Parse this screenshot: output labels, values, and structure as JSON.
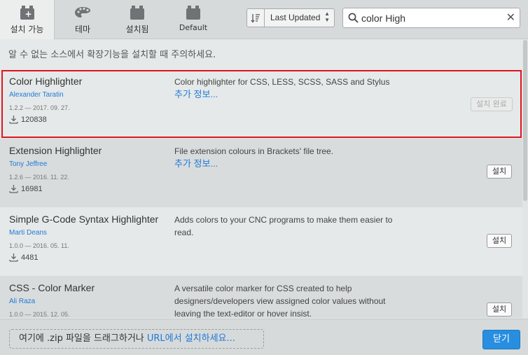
{
  "tabs": [
    {
      "label": "설치 가능",
      "icon": "box-plus-icon",
      "active": true
    },
    {
      "label": "테마",
      "icon": "palette-icon",
      "active": false
    },
    {
      "label": "설치됨",
      "icon": "box-icon",
      "active": false
    },
    {
      "label": "Default",
      "icon": "box-icon",
      "active": false
    }
  ],
  "sort": {
    "label": "Last Updated"
  },
  "search": {
    "value": "color High",
    "placeholder": ""
  },
  "warning": "알 수 없는 소스에서 확장기능을 설치할 때 주의하세요.",
  "extensions": [
    {
      "name": "Color Highlighter",
      "author": "Alexander Taratin",
      "version_date": "1.2.2 — 2017. 09. 27.",
      "downloads": "120838",
      "description": "Color highlighter for CSS, LESS, SCSS, SASS and Stylus",
      "more_info": "추가 정보...",
      "action": "설치 완료"
    },
    {
      "name": "Extension Highlighter",
      "author": "Tony Jeffree",
      "version_date": "1.2.6 — 2016. 11. 22.",
      "downloads": "16981",
      "description": "File extension colours in Brackets' file tree.",
      "more_info": "추가 정보...",
      "action": "설치"
    },
    {
      "name": "Simple G-Code Syntax Highlighter",
      "author": "Marti Deans",
      "version_date": "1.0.0 — 2016. 05. 11.",
      "downloads": "4481",
      "description": "Adds colors to your CNC programs to make them easier to read.",
      "more_info": "",
      "action": "설치"
    },
    {
      "name": "CSS - Color Marker",
      "author": "Ali Raza",
      "version_date": "1.0.0 — 2015. 12. 05.",
      "downloads": "",
      "description": "A versatile color marker for CSS created to help designers/developers view assigned color values without leaving the text-editor or hover insist.",
      "more_info": "",
      "action": "설치"
    }
  ],
  "footer": {
    "drop_text": "여기에 .zip 파일을 드래그하거나 ",
    "drop_link": "URL에서 설치하세요...",
    "close_label": "닫기"
  },
  "colors": {
    "accent": "#288edf",
    "link": "#1e7ad6",
    "highlight_border": "#e0141f"
  }
}
